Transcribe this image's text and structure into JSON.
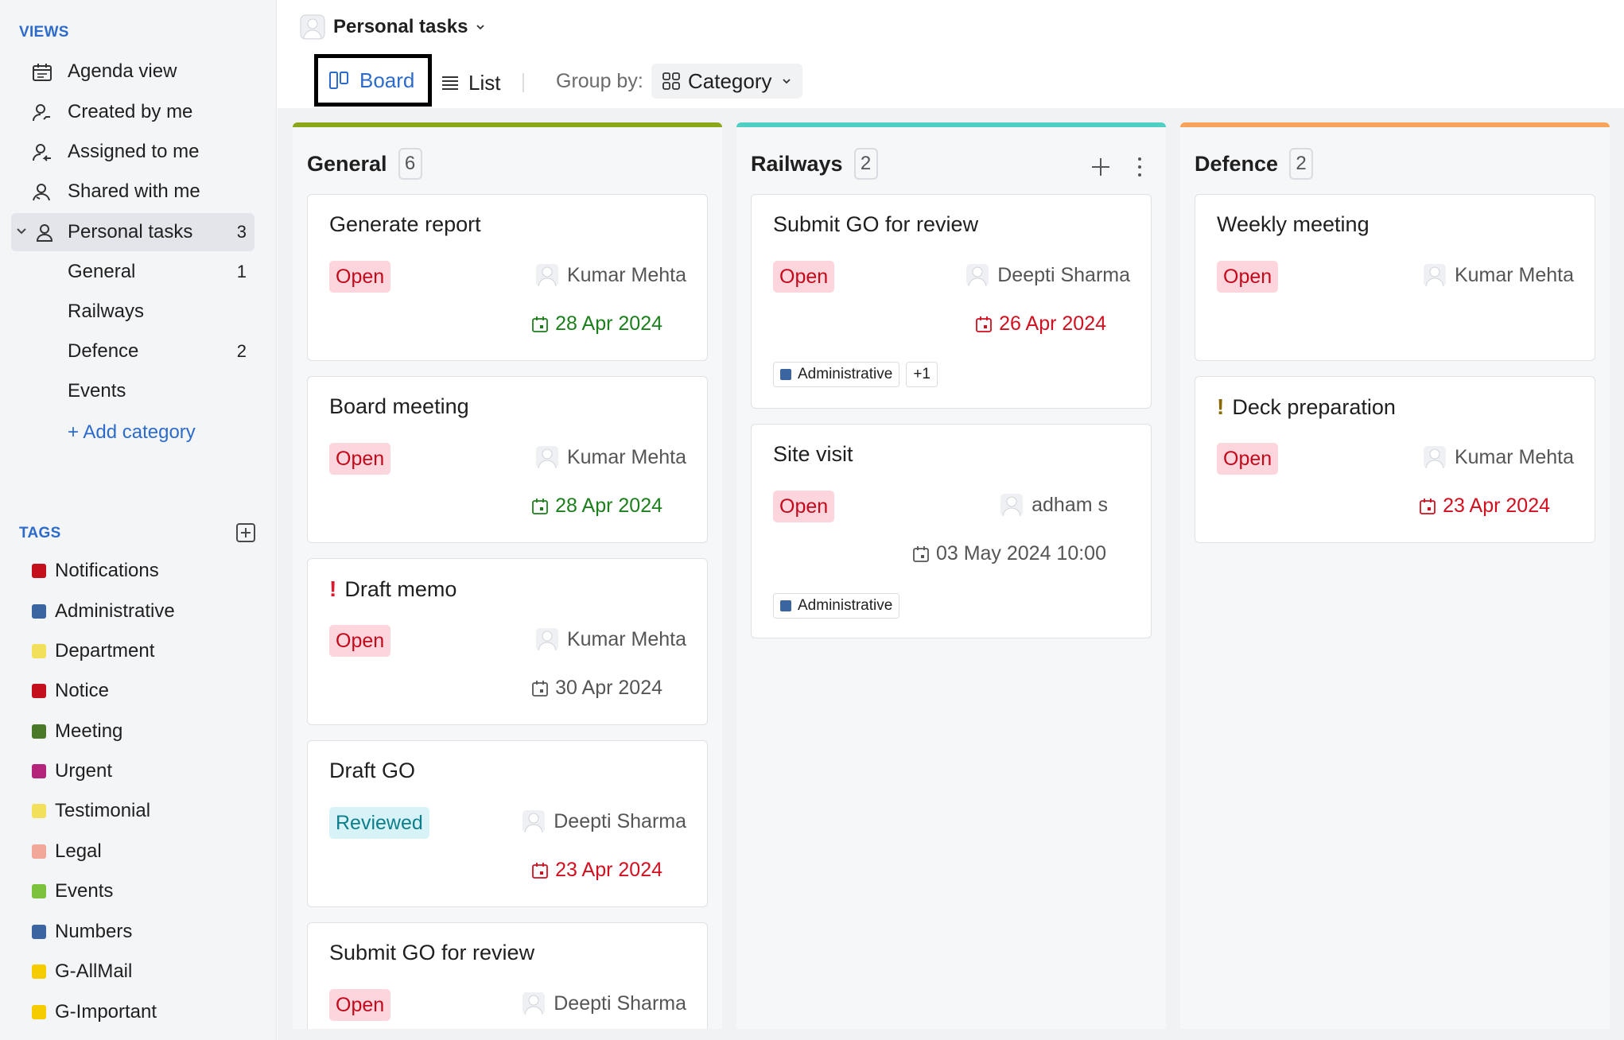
{
  "sidebar": {
    "views_title": "VIEWS",
    "views": [
      {
        "label": "Agenda view",
        "icon": "calendar-icon"
      },
      {
        "label": "Created by me",
        "icon": "user-created-icon"
      },
      {
        "label": "Assigned to me",
        "icon": "user-assigned-icon"
      },
      {
        "label": "Shared with me",
        "icon": "user-shared-icon"
      }
    ],
    "personal": {
      "label": "Personal tasks",
      "count": "3",
      "icon": "user-icon"
    },
    "categories": [
      {
        "label": "General",
        "count": "1"
      },
      {
        "label": "Railways",
        "count": ""
      },
      {
        "label": "Defence",
        "count": "2"
      },
      {
        "label": "Events",
        "count": ""
      }
    ],
    "add_category": "+ Add category",
    "tags_title": "TAGS",
    "tags": [
      {
        "label": "Notifications",
        "color": "#c4101d"
      },
      {
        "label": "Administrative",
        "color": "#3a65a0"
      },
      {
        "label": "Department",
        "color": "#f3e05a"
      },
      {
        "label": "Notice",
        "color": "#c4101d"
      },
      {
        "label": "Meeting",
        "color": "#4a7a28"
      },
      {
        "label": "Urgent",
        "color": "#b3247a"
      },
      {
        "label": "Testimonial",
        "color": "#f3e05a"
      },
      {
        "label": "Legal",
        "color": "#f2a898"
      },
      {
        "label": "Events",
        "color": "#7cc23c"
      },
      {
        "label": "Numbers",
        "color": "#3a65a0"
      },
      {
        "label": "G-AllMail",
        "color": "#f5cc00"
      },
      {
        "label": "G-Important",
        "color": "#f5cc00"
      }
    ]
  },
  "header": {
    "project": "Personal tasks",
    "board_label": "Board",
    "list_label": "List",
    "group_by_label": "Group by:",
    "group_value": "Category"
  },
  "columns": [
    {
      "title": "General",
      "count": "6",
      "color": "#8aa81a",
      "cards": [
        {
          "title": "Generate report",
          "status": "Open",
          "assignee": "Kumar Mehta",
          "due": "28 Apr 2024",
          "due_color": "green"
        },
        {
          "title": "Board meeting",
          "status": "Open",
          "assignee": "Kumar Mehta",
          "due": "28 Apr 2024",
          "due_color": "green"
        },
        {
          "title": "Draft memo",
          "priority": "!",
          "status": "Open",
          "assignee": "Kumar Mehta",
          "due": "30 Apr 2024",
          "due_color": "grey"
        },
        {
          "title": "Draft GO",
          "status": "Reviewed",
          "assignee": "Deepti Sharma",
          "due": "23 Apr 2024",
          "due_color": "red"
        },
        {
          "title": "Submit GO for review",
          "status": "Open",
          "assignee": "Deepti Sharma"
        }
      ]
    },
    {
      "title": "Railways",
      "count": "2",
      "color": "#4fcfc4",
      "cards": [
        {
          "title": "Submit GO for review",
          "status": "Open",
          "assignee": "Deepti Sharma",
          "due": "26 Apr 2024",
          "due_color": "red",
          "tags": [
            {
              "label": "Administrative",
              "color": "#3a65a0"
            }
          ],
          "more": "+1"
        },
        {
          "title": "Site visit",
          "status": "Open",
          "assignee": "adham s",
          "due": "03 May 2024 10:00",
          "due_color": "grey",
          "tags": [
            {
              "label": "Administrative",
              "color": "#3a65a0"
            }
          ]
        }
      ]
    },
    {
      "title": "Defence",
      "count": "2",
      "color": "#f7a35c",
      "cards": [
        {
          "title": "Weekly meeting",
          "status": "Open",
          "assignee": "Kumar Mehta"
        },
        {
          "title": "Deck preparation",
          "priority": "!",
          "status": "Open",
          "assignee": "Kumar Mehta",
          "due": "23 Apr 2024",
          "due_color": "red"
        }
      ]
    }
  ]
}
